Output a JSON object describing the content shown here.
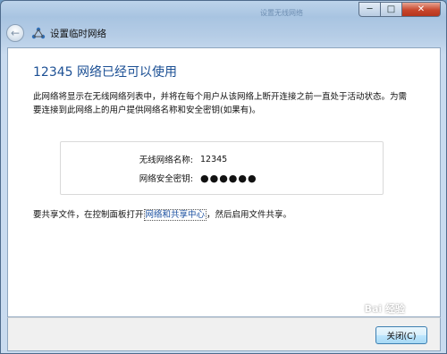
{
  "window": {
    "ghost_title": "设置无线网络",
    "min_label": "─",
    "max_label": "□",
    "close_label": "✕"
  },
  "nav": {
    "back_label": "←",
    "title": "设置临时网络"
  },
  "main": {
    "heading": "12345 网络已经可以使用",
    "description": "此网络将显示在无线网络列表中，并将在每个用户从该网络上断开连接之前一直处于活动状态。为需要连接到此网络上的用户提供网络名称和安全密钥(如果有)。",
    "info": {
      "name_label": "无线网络名称:",
      "name_value": "12345",
      "key_label": "网络安全密钥:",
      "key_value": "●●●●●●"
    },
    "share_prefix": "要共享文件，在控制面板打开",
    "share_link": "网络和共享中心",
    "share_suffix": "，然后启用文件共享。"
  },
  "footer": {
    "close_button": "关闭(C)"
  },
  "watermark": "Bai 经验"
}
